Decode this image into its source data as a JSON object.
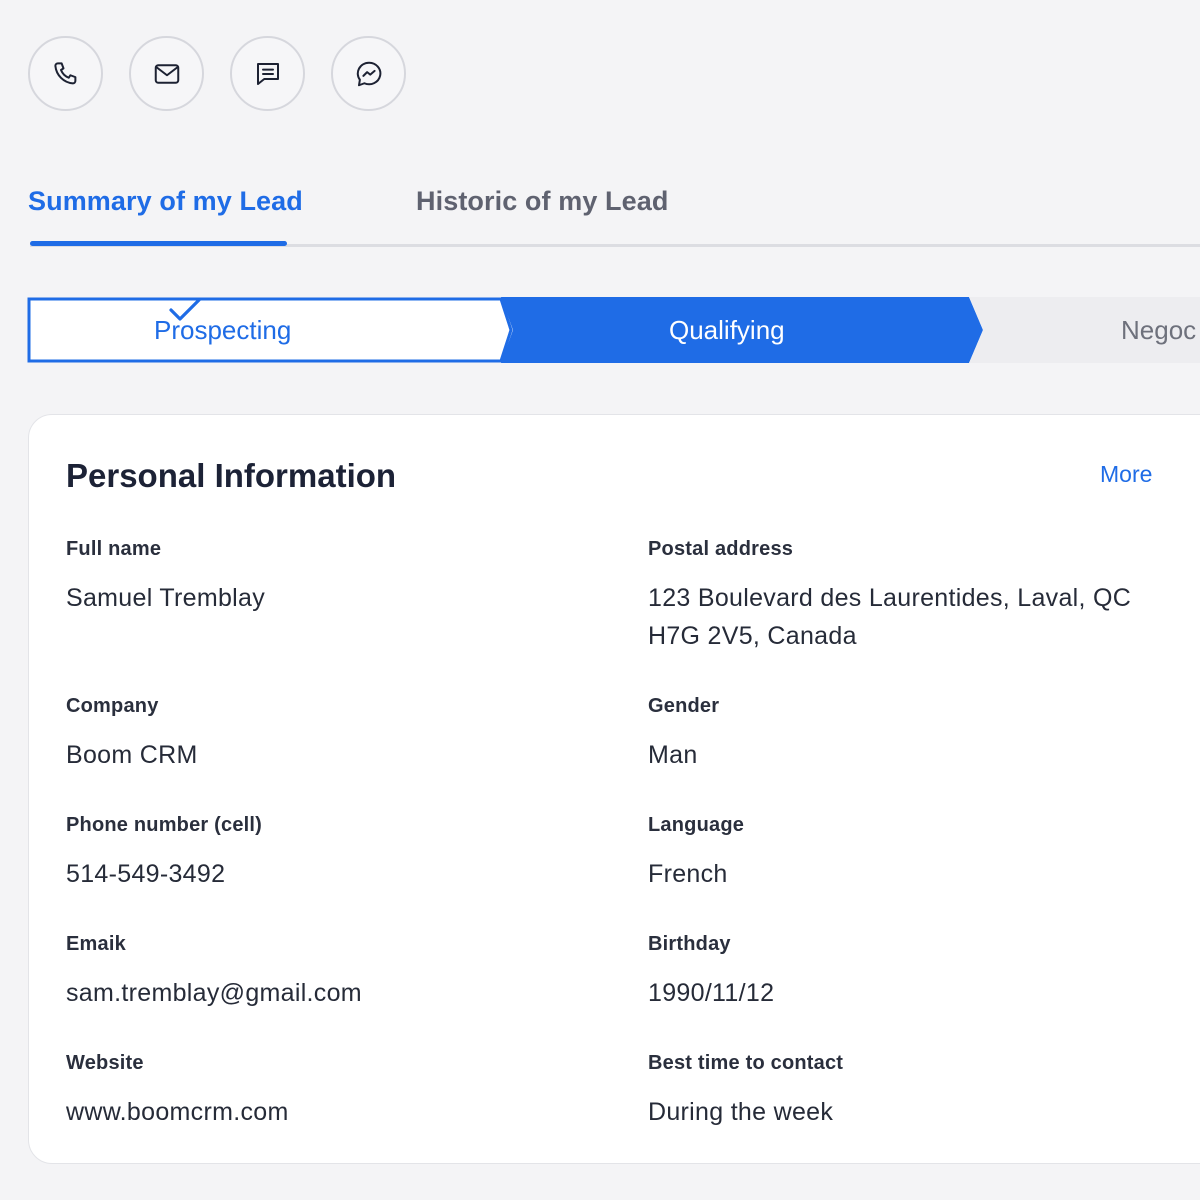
{
  "actions": [
    {
      "icon": "phone-icon"
    },
    {
      "icon": "mail-icon"
    },
    {
      "icon": "message-icon"
    },
    {
      "icon": "messenger-icon"
    }
  ],
  "tabs": [
    {
      "label": "Summary of my Lead",
      "active": true
    },
    {
      "label": "Historic of my Lead",
      "active": false
    }
  ],
  "stepper": {
    "steps": [
      {
        "label": "Prospecting",
        "state": "completed"
      },
      {
        "label": "Qualifying",
        "state": "current"
      },
      {
        "label": "Negoc",
        "state": "upcoming"
      }
    ],
    "colors": {
      "accent": "#1f6ce6",
      "upcoming": "#ededf0"
    }
  },
  "card": {
    "title": "Personal Information",
    "more_label": "More",
    "fields": {
      "full_name": {
        "label": "Full name",
        "value": "Samuel Tremblay"
      },
      "postal_address": {
        "label": "Postal address",
        "line1": "123 Boulevard des Laurentides, Laval, QC",
        "line2": "H7G 2V5, Canada"
      },
      "company": {
        "label": "Company",
        "value": "Boom CRM"
      },
      "gender": {
        "label": "Gender",
        "value": "Man"
      },
      "phone": {
        "label": "Phone number (cell)",
        "value": "514-549-3492"
      },
      "language": {
        "label": "Language",
        "value": "French"
      },
      "email": {
        "label": "Emaik",
        "value": "sam.tremblay@gmail.com"
      },
      "birthday": {
        "label": "Birthday",
        "value": "1990/11/12"
      },
      "website": {
        "label": "Website",
        "value": "www.boomcrm.com"
      },
      "best_time": {
        "label": "Best time to contact",
        "value": "During the week"
      }
    }
  }
}
